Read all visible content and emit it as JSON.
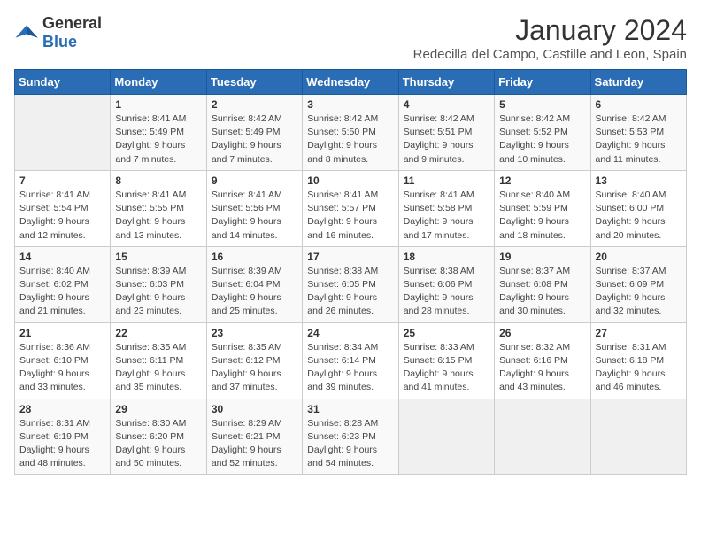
{
  "logo": {
    "general": "General",
    "blue": "Blue"
  },
  "title": "January 2024",
  "location": "Redecilla del Campo, Castille and Leon, Spain",
  "days_header": [
    "Sunday",
    "Monday",
    "Tuesday",
    "Wednesday",
    "Thursday",
    "Friday",
    "Saturday"
  ],
  "weeks": [
    [
      {
        "day": "",
        "sunrise": "",
        "sunset": "",
        "daylight": ""
      },
      {
        "day": "1",
        "sunrise": "Sunrise: 8:41 AM",
        "sunset": "Sunset: 5:49 PM",
        "daylight": "Daylight: 9 hours and 7 minutes."
      },
      {
        "day": "2",
        "sunrise": "Sunrise: 8:42 AM",
        "sunset": "Sunset: 5:49 PM",
        "daylight": "Daylight: 9 hours and 7 minutes."
      },
      {
        "day": "3",
        "sunrise": "Sunrise: 8:42 AM",
        "sunset": "Sunset: 5:50 PM",
        "daylight": "Daylight: 9 hours and 8 minutes."
      },
      {
        "day": "4",
        "sunrise": "Sunrise: 8:42 AM",
        "sunset": "Sunset: 5:51 PM",
        "daylight": "Daylight: 9 hours and 9 minutes."
      },
      {
        "day": "5",
        "sunrise": "Sunrise: 8:42 AM",
        "sunset": "Sunset: 5:52 PM",
        "daylight": "Daylight: 9 hours and 10 minutes."
      },
      {
        "day": "6",
        "sunrise": "Sunrise: 8:42 AM",
        "sunset": "Sunset: 5:53 PM",
        "daylight": "Daylight: 9 hours and 11 minutes."
      }
    ],
    [
      {
        "day": "7",
        "sunrise": "Sunrise: 8:41 AM",
        "sunset": "Sunset: 5:54 PM",
        "daylight": "Daylight: 9 hours and 12 minutes."
      },
      {
        "day": "8",
        "sunrise": "Sunrise: 8:41 AM",
        "sunset": "Sunset: 5:55 PM",
        "daylight": "Daylight: 9 hours and 13 minutes."
      },
      {
        "day": "9",
        "sunrise": "Sunrise: 8:41 AM",
        "sunset": "Sunset: 5:56 PM",
        "daylight": "Daylight: 9 hours and 14 minutes."
      },
      {
        "day": "10",
        "sunrise": "Sunrise: 8:41 AM",
        "sunset": "Sunset: 5:57 PM",
        "daylight": "Daylight: 9 hours and 16 minutes."
      },
      {
        "day": "11",
        "sunrise": "Sunrise: 8:41 AM",
        "sunset": "Sunset: 5:58 PM",
        "daylight": "Daylight: 9 hours and 17 minutes."
      },
      {
        "day": "12",
        "sunrise": "Sunrise: 8:40 AM",
        "sunset": "Sunset: 5:59 PM",
        "daylight": "Daylight: 9 hours and 18 minutes."
      },
      {
        "day": "13",
        "sunrise": "Sunrise: 8:40 AM",
        "sunset": "Sunset: 6:00 PM",
        "daylight": "Daylight: 9 hours and 20 minutes."
      }
    ],
    [
      {
        "day": "14",
        "sunrise": "Sunrise: 8:40 AM",
        "sunset": "Sunset: 6:02 PM",
        "daylight": "Daylight: 9 hours and 21 minutes."
      },
      {
        "day": "15",
        "sunrise": "Sunrise: 8:39 AM",
        "sunset": "Sunset: 6:03 PM",
        "daylight": "Daylight: 9 hours and 23 minutes."
      },
      {
        "day": "16",
        "sunrise": "Sunrise: 8:39 AM",
        "sunset": "Sunset: 6:04 PM",
        "daylight": "Daylight: 9 hours and 25 minutes."
      },
      {
        "day": "17",
        "sunrise": "Sunrise: 8:38 AM",
        "sunset": "Sunset: 6:05 PM",
        "daylight": "Daylight: 9 hours and 26 minutes."
      },
      {
        "day": "18",
        "sunrise": "Sunrise: 8:38 AM",
        "sunset": "Sunset: 6:06 PM",
        "daylight": "Daylight: 9 hours and 28 minutes."
      },
      {
        "day": "19",
        "sunrise": "Sunrise: 8:37 AM",
        "sunset": "Sunset: 6:08 PM",
        "daylight": "Daylight: 9 hours and 30 minutes."
      },
      {
        "day": "20",
        "sunrise": "Sunrise: 8:37 AM",
        "sunset": "Sunset: 6:09 PM",
        "daylight": "Daylight: 9 hours and 32 minutes."
      }
    ],
    [
      {
        "day": "21",
        "sunrise": "Sunrise: 8:36 AM",
        "sunset": "Sunset: 6:10 PM",
        "daylight": "Daylight: 9 hours and 33 minutes."
      },
      {
        "day": "22",
        "sunrise": "Sunrise: 8:35 AM",
        "sunset": "Sunset: 6:11 PM",
        "daylight": "Daylight: 9 hours and 35 minutes."
      },
      {
        "day": "23",
        "sunrise": "Sunrise: 8:35 AM",
        "sunset": "Sunset: 6:12 PM",
        "daylight": "Daylight: 9 hours and 37 minutes."
      },
      {
        "day": "24",
        "sunrise": "Sunrise: 8:34 AM",
        "sunset": "Sunset: 6:14 PM",
        "daylight": "Daylight: 9 hours and 39 minutes."
      },
      {
        "day": "25",
        "sunrise": "Sunrise: 8:33 AM",
        "sunset": "Sunset: 6:15 PM",
        "daylight": "Daylight: 9 hours and 41 minutes."
      },
      {
        "day": "26",
        "sunrise": "Sunrise: 8:32 AM",
        "sunset": "Sunset: 6:16 PM",
        "daylight": "Daylight: 9 hours and 43 minutes."
      },
      {
        "day": "27",
        "sunrise": "Sunrise: 8:31 AM",
        "sunset": "Sunset: 6:18 PM",
        "daylight": "Daylight: 9 hours and 46 minutes."
      }
    ],
    [
      {
        "day": "28",
        "sunrise": "Sunrise: 8:31 AM",
        "sunset": "Sunset: 6:19 PM",
        "daylight": "Daylight: 9 hours and 48 minutes."
      },
      {
        "day": "29",
        "sunrise": "Sunrise: 8:30 AM",
        "sunset": "Sunset: 6:20 PM",
        "daylight": "Daylight: 9 hours and 50 minutes."
      },
      {
        "day": "30",
        "sunrise": "Sunrise: 8:29 AM",
        "sunset": "Sunset: 6:21 PM",
        "daylight": "Daylight: 9 hours and 52 minutes."
      },
      {
        "day": "31",
        "sunrise": "Sunrise: 8:28 AM",
        "sunset": "Sunset: 6:23 PM",
        "daylight": "Daylight: 9 hours and 54 minutes."
      },
      {
        "day": "",
        "sunrise": "",
        "sunset": "",
        "daylight": ""
      },
      {
        "day": "",
        "sunrise": "",
        "sunset": "",
        "daylight": ""
      },
      {
        "day": "",
        "sunrise": "",
        "sunset": "",
        "daylight": ""
      }
    ]
  ]
}
